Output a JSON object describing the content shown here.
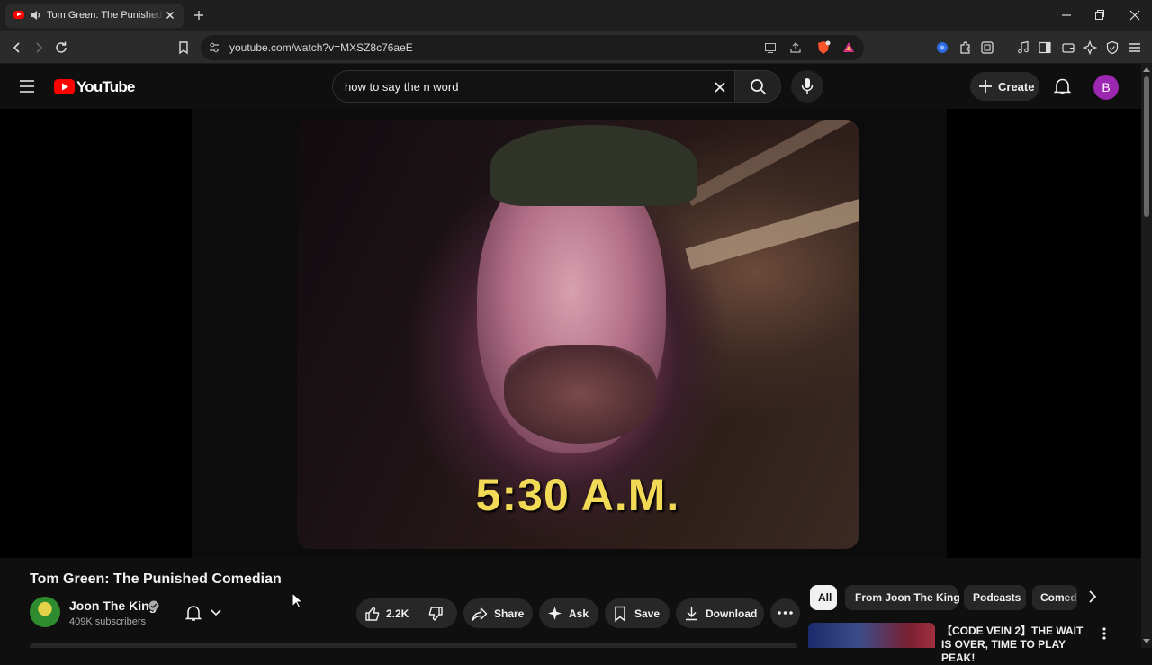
{
  "browser": {
    "tab_title": "Tom Green: The Punished Comedian | Joon The King - YouTube",
    "url": "youtube.com/watch?v=MXSZ8c76aeE"
  },
  "youtube": {
    "logo_text": "YouTube",
    "search_query": "how to say the n word",
    "create_label": "Create",
    "avatar_letter": "B"
  },
  "video": {
    "caption": "5:30 A.M.",
    "title": "Tom Green: The Punished Comedian"
  },
  "channel": {
    "name": "Joon The King",
    "subscribers": "409K subscribers"
  },
  "actions": {
    "likes": "2.2K",
    "share": "Share",
    "ask": "Ask",
    "save": "Save",
    "download": "Download"
  },
  "chips": [
    "All",
    "From Joon The King",
    "Podcasts",
    "Comedy"
  ],
  "recommendation": {
    "title": "【CODE VEIN 2】THE WAIT IS OVER, TIME TO PLAY PEAK!"
  },
  "colors": {
    "youtube_red": "#ff0000",
    "caption_yellow": "#f2da57",
    "avatar_purple": "#9c27b0"
  }
}
